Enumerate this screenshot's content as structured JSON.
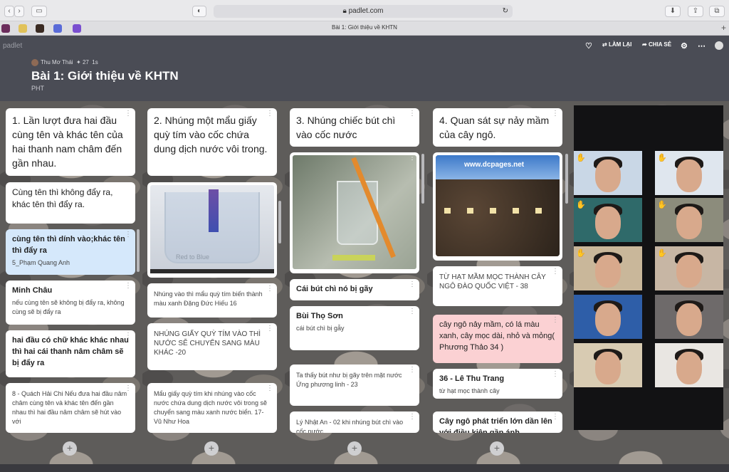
{
  "browser": {
    "url": "padlet.com",
    "tab_title": "Bài 1: Giới thiệu về KHTN"
  },
  "header": {
    "logo": "padlet",
    "author": "Thu Mơ Thái",
    "likes": "✦ 27",
    "time": "1s",
    "title": "Bài 1: Giới thiệu về KHTN",
    "subtitle": "PHT",
    "remake": "LÀM LẠI",
    "share": "CHIA SẺ"
  },
  "columns": [
    {
      "heading": "1. Lần lượt đưa hai đầu cùng tên và khác tên của hai thanh nam châm đến gần nhau.",
      "cards": [
        {
          "title": "",
          "body": "Cùng tên thì không đẩy ra, khác tên thì đẩy ra."
        },
        {
          "title": "cùng tên thì dính vào;khác tên thì đẩy ra",
          "body": "5_Phạm Quang Anh"
        },
        {
          "title": "Minh Châu",
          "body": "nếu cùng tên sẽ không bị đẩy ra, không cùng sẽ bị đẩy ra"
        },
        {
          "title": "hai đầu có chữ khác khác nhau thì hai cái thanh nâm châm sẽ bị đẩy ra",
          "body": ""
        },
        {
          "title": "",
          "body": "8 - Quách Hải Chi Nếu đưa hai đầu nâm châm cùng tên và khác tên đến gần nhau thì hai đầu nâm châm sẽ hút vào với"
        }
      ]
    },
    {
      "heading": "2. Nhúng một mẩu giấy quỳ tím vào cốc chứa dung dịch nước vôi trong.",
      "image_caption": "Red to Blue",
      "cards": [
        {
          "body": "Nhúng vào thì mẩu quỳ tím biến thành màu xanh Đặng Đức Hiếu 16"
        },
        {
          "body": "NHÚNG GIẤY QUỲ TÍM VÀO THÌ NƯỚC SẼ CHUYỂN SANG MÀU KHÁC -20"
        },
        {
          "body": "Mẩu giấy quỳ tím khi nhúng vào cốc nước chứa dung dịch nước vôi trong sẽ chuyển sang màu xanh nước biển. 17- Vũ Như Hoa"
        }
      ]
    },
    {
      "heading": "3. Nhúng chiếc bút chì vào cốc nước",
      "cards": [
        {
          "title": "Cái bút chì nó bị gãy",
          "body": ""
        },
        {
          "title": "Bùi Thọ Sơn",
          "body": "cái bút chì bị gẫy"
        },
        {
          "title": "",
          "body": "Ta thấy bút như bị gãy trên mặt nước Ứng phương linh - 23"
        },
        {
          "title": "",
          "body": "Lý Nhật An - 02 khi nhúng bút chì vào cốc nước"
        }
      ]
    },
    {
      "heading": "4. Quan sát sự nảy mầm của cây ngô.",
      "image_caption": "www.dcpages.net",
      "cards": [
        {
          "body": "TỪ HẠT MẦM MỌC THÀNH CÂY NGÔ ĐÀO QUỐC VIỆT - 38"
        },
        {
          "body": "cây ngô nảy mầm, có lá màu xanh, cây mọc dài, nhỏ và mỏng( Phương Thảo 34 )"
        },
        {
          "title": "36 - Lê Thu Trang",
          "body": "từ hạt mọc thành cây"
        },
        {
          "title": "Cây ngô phát triển lớn dần lên với điều kiện gần ánh",
          "body": ""
        }
      ]
    }
  ],
  "add_label": "+"
}
